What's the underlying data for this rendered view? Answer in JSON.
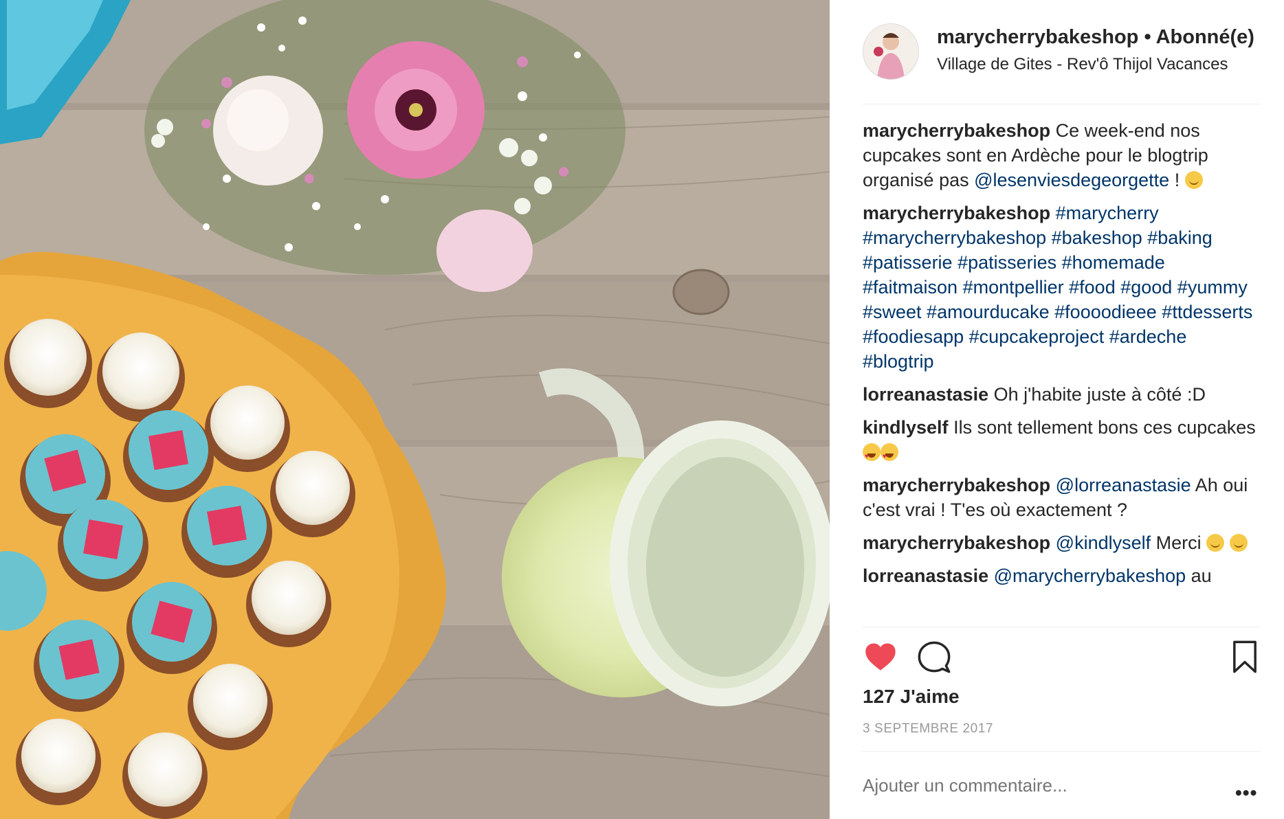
{
  "post": {
    "username": "marycherrybakeshop",
    "separator": "•",
    "follow_status": "Abonné(e)",
    "location": "Village de Gites - Rev'ô Thijol Vacances",
    "likes": "127 J'aime",
    "date": "3 SEPTEMBRE 2017",
    "add_comment_placeholder": "Ajouter un commentaire...",
    "more_label": "•••"
  },
  "comments": [
    {
      "user": "marycherrybakeshop",
      "parts": [
        {
          "t": "text",
          "v": "Ce week-end nos cupcakes sont en Ardèche pour le blogtrip organisé pas "
        },
        {
          "t": "link",
          "v": "@lesenviesdegeorgette"
        },
        {
          "t": "text",
          "v": " ! "
        },
        {
          "t": "emoji",
          "v": "smile"
        }
      ]
    },
    {
      "user": "marycherrybakeshop",
      "parts": [
        {
          "t": "link",
          "v": "#marycherry #marycherrybakeshop #bakeshop #baking #patisserie #patisseries #homemade #faitmaison #montpellier #food #good #yummy #sweet #amourducake #foooodieee #ttdesserts #foodiesapp #cupcakeproject #ardeche #blogtrip"
        }
      ]
    },
    {
      "user": "lorreanastasie",
      "parts": [
        {
          "t": "text",
          "v": "Oh j'habite juste à côté :D"
        }
      ]
    },
    {
      "user": "kindlyself",
      "parts": [
        {
          "t": "text",
          "v": "Ils sont tellement bons ces cupcakes "
        },
        {
          "t": "emoji",
          "v": "heart"
        },
        {
          "t": "emoji",
          "v": "heart"
        }
      ]
    },
    {
      "user": "marycherrybakeshop",
      "parts": [
        {
          "t": "link",
          "v": "@lorreanastasie"
        },
        {
          "t": "text",
          "v": " Ah oui c'est vrai ! T'es où exactement ?"
        }
      ]
    },
    {
      "user": "marycherrybakeshop",
      "parts": [
        {
          "t": "link",
          "v": "@kindlyself"
        },
        {
          "t": "text",
          "v": " Merci "
        },
        {
          "t": "emoji",
          "v": "smile"
        },
        {
          "t": "text",
          "v": " "
        },
        {
          "t": "emoji",
          "v": "smile"
        }
      ]
    },
    {
      "user": "lorreanastasie",
      "parts": [
        {
          "t": "link",
          "v": "@marycherrybakeshop"
        },
        {
          "t": "text",
          "v": " au"
        }
      ]
    }
  ],
  "icons": {
    "like": "heart-icon",
    "comment": "comment-bubble-icon",
    "save": "bookmark-icon"
  },
  "colors": {
    "like_red": "#ed4956",
    "link_blue": "#003569",
    "muted": "#999999"
  }
}
